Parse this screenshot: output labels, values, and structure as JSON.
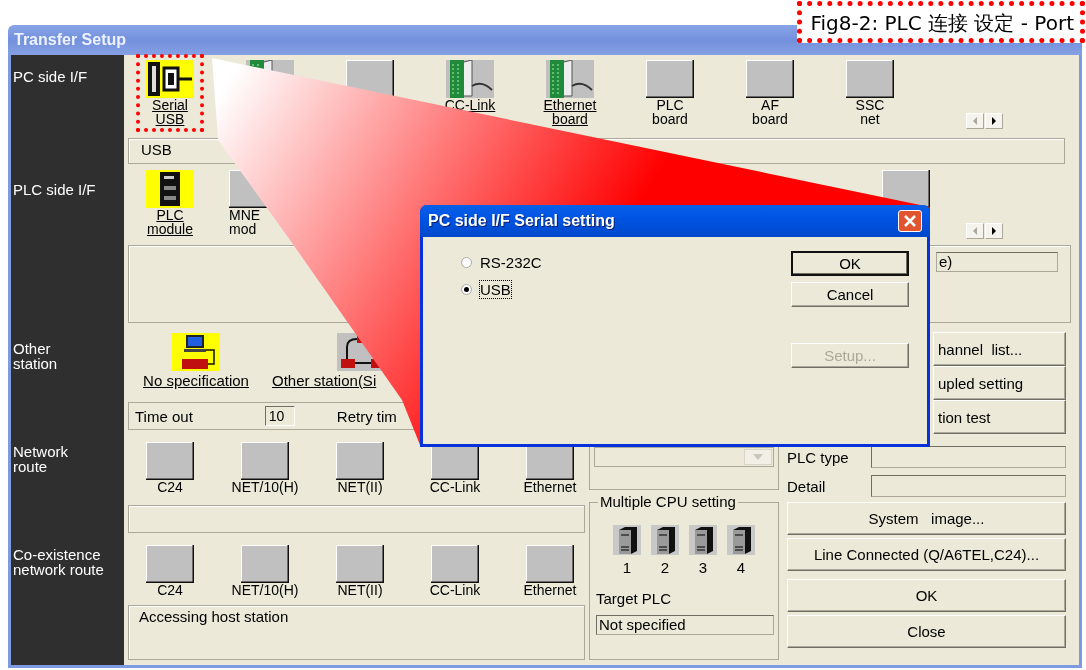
{
  "caption": "Fig8-2: PLC 连接 设定 - Port",
  "window": {
    "title": "Transfer Setup"
  },
  "pc_side_if": {
    "label": "PC side I/F",
    "tiles": [
      {
        "kind": "serial",
        "lines": [
          "Serial",
          "USB"
        ],
        "selected": true,
        "annotated": true
      },
      {
        "kind": "card",
        "selected": false,
        "annotated": false
      },
      {
        "kind": "blank",
        "selected": false,
        "annotated": false
      },
      {
        "kind": "card",
        "lines": [
          "CC-Link"
        ],
        "selected": false,
        "annotated": false
      },
      {
        "kind": "card",
        "lines": [
          "Ethernet",
          "board"
        ],
        "selected": false,
        "annotated": false
      },
      {
        "kind": "blank",
        "lines": [
          "PLC",
          "board"
        ],
        "selected": false,
        "annotated": false
      },
      {
        "kind": "blank",
        "lines": [
          "AF",
          "board"
        ],
        "selected": false,
        "annotated": false
      },
      {
        "kind": "blank",
        "lines": [
          "SSC",
          "net"
        ],
        "selected": false,
        "annotated": false
      }
    ],
    "info": "USB"
  },
  "plc_side_if": {
    "label": "PLC side I/F",
    "tiles": [
      {
        "kind": "plc",
        "lines": [
          "PLC",
          "module"
        ],
        "selected": true
      },
      {
        "kind": "blank",
        "lines": [
          "MNE",
          "mod"
        ]
      }
    ],
    "trailing_tiles": [
      {
        "kind": "blank",
        "selected": false
      }
    ],
    "field_value": "e)"
  },
  "other_station": {
    "label": "Other station",
    "tiles": [
      {
        "kind": "station",
        "text": "No specification",
        "selected": true
      },
      {
        "kind": "network",
        "text": "Other station(Si",
        "selected": false
      }
    ],
    "timeout_label": "Time out",
    "timeout_value": "10",
    "retry_label": "Retry tim"
  },
  "network_route": {
    "label": "Network route",
    "tiles": [
      {
        "kind": "blank",
        "lines": [
          "C24"
        ]
      },
      {
        "kind": "blank",
        "lines": [
          "NET/10(H)"
        ]
      },
      {
        "kind": "blank",
        "lines": [
          "NET(II)"
        ]
      },
      {
        "kind": "blank",
        "lines": [
          "CC-Link"
        ]
      },
      {
        "kind": "blank",
        "lines": [
          "Ethernet"
        ]
      }
    ]
  },
  "coexistence_route": {
    "label": "Co-existence network route",
    "tiles": [
      {
        "kind": "blank",
        "lines": [
          "C24"
        ]
      },
      {
        "kind": "blank",
        "lines": [
          "NET/10(H)"
        ]
      },
      {
        "kind": "blank",
        "lines": [
          "NET(II)"
        ]
      },
      {
        "kind": "blank",
        "lines": [
          "CC-Link"
        ]
      },
      {
        "kind": "blank",
        "lines": [
          "Ethernet"
        ]
      }
    ],
    "info": "Accessing host station"
  },
  "multiple_cpu": {
    "title": "Multiple CPU setting",
    "cpus": [
      "1",
      "2",
      "3",
      "4"
    ],
    "target_label": "Target PLC",
    "target_value": "Not specified"
  },
  "side_buttons": [
    "hannel  list...",
    "upled setting",
    "tion test"
  ],
  "plc_type_label": "PLC type",
  "detail_label": "Detail",
  "action_buttons": [
    "System   image...",
    "Line Connected (Q/A6TEL,C24)...",
    "OK",
    "Close"
  ],
  "dialog": {
    "title": "PC side I/F  Serial setting",
    "options": [
      {
        "label": "RS-232C",
        "selected": false
      },
      {
        "label": "USB",
        "selected": true
      }
    ],
    "buttons": [
      {
        "label": "OK",
        "default": true,
        "disabled": false
      },
      {
        "label": "Cancel",
        "default": false,
        "disabled": false
      },
      {
        "label": "Setup...",
        "default": false,
        "disabled": true
      }
    ]
  }
}
